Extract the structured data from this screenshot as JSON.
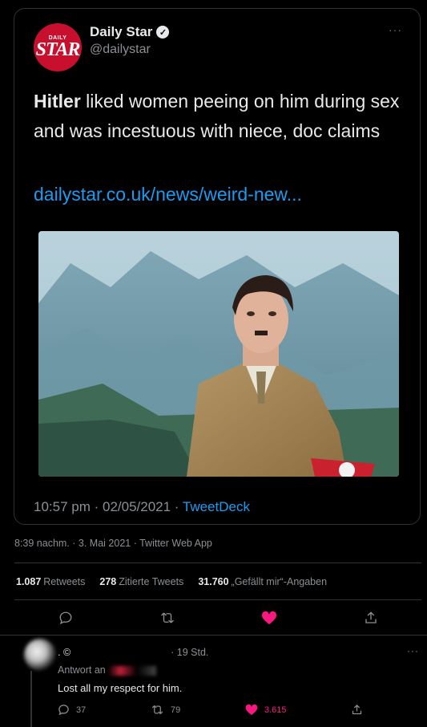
{
  "quoted_tweet": {
    "brand_small": "DAILY",
    "brand_big": "STAR",
    "name": "Daily Star",
    "verified_glyph": "✓",
    "handle": "@dailystar",
    "more": "···",
    "text_bold": "Hitler",
    "text_rest": " liked women peeing on him during sex and was incestuous with niece, doc claims",
    "link": "dailystar.co.uk/news/weird-new...",
    "meta_time": "10:57 pm · 02/05/2021 · ",
    "meta_source": "TweetDeck"
  },
  "post": {
    "timestamp": "8:39 nachm. · 3. Mai 2021 · Twitter Web App",
    "stats": [
      {
        "count": "1.087",
        "label": "Retweets"
      },
      {
        "count": "278",
        "label": "Zitierte Tweets"
      },
      {
        "count": "31.760",
        "label": "„Gefällt mir“-Angaben"
      }
    ],
    "actions": {
      "reply_icon": "reply-icon",
      "retweet_icon": "retweet-icon",
      "like_icon": "heart-icon-filled",
      "share_icon": "share-icon"
    }
  },
  "reply": {
    "name_fragment": ". ©",
    "time": "· 19 Std.",
    "replying_prefix": "Antwort an",
    "text": "Lost all my respect for him.",
    "more": "···",
    "reply_count": "37",
    "retweet_count": "79",
    "like_count": "3.615"
  },
  "colors": {
    "background": "#000000",
    "link": "#1d9bf0",
    "like": "#f91880",
    "muted": "#8b8f93",
    "brand": "#c8102e"
  }
}
